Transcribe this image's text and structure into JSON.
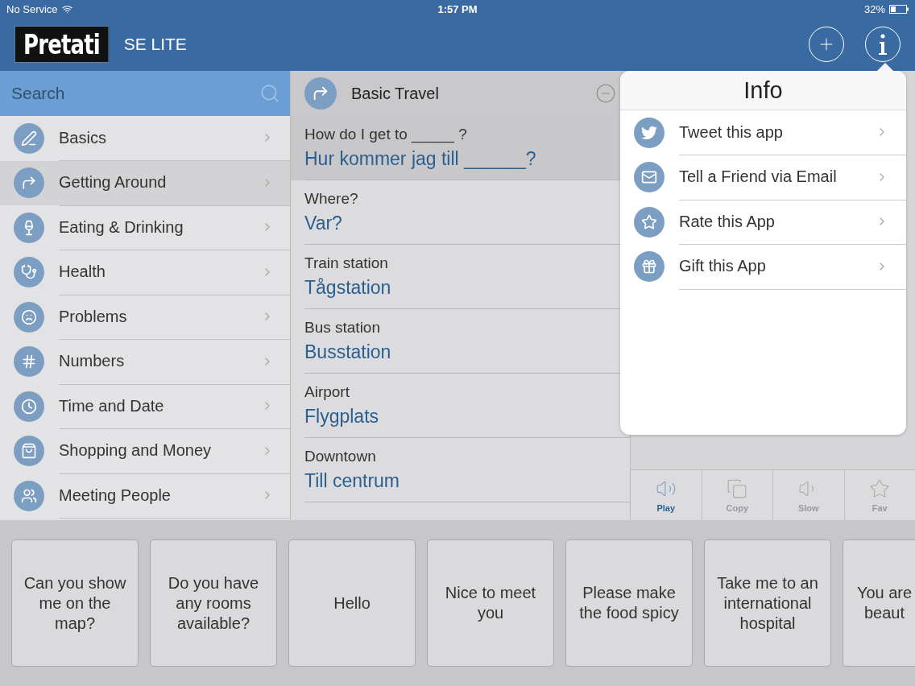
{
  "status_bar": {
    "carrier": "No Service",
    "time": "1:57 PM",
    "battery": "32%"
  },
  "header": {
    "logo": "Pretati",
    "edition": "SE LITE"
  },
  "sidebar": {
    "search": {
      "placeholder": "Search"
    },
    "items": [
      {
        "label": "Basics",
        "selected": false
      },
      {
        "label": "Getting Around",
        "selected": true
      },
      {
        "label": "Eating & Drinking",
        "selected": false
      },
      {
        "label": "Health",
        "selected": false
      },
      {
        "label": "Problems",
        "selected": false
      },
      {
        "label": "Numbers",
        "selected": false
      },
      {
        "label": "Time and Date",
        "selected": false
      },
      {
        "label": "Shopping and Money",
        "selected": false
      },
      {
        "label": "Meeting People",
        "selected": false
      }
    ]
  },
  "phrases": {
    "title": "Basic Travel",
    "items": [
      {
        "english": "How do I get to _____ ?",
        "translation": "Hur kommer jag till ______?",
        "selected": true
      },
      {
        "english": "Where?",
        "translation": "Var?",
        "selected": false
      },
      {
        "english": "Train station",
        "translation": "Tågstation",
        "selected": false
      },
      {
        "english": "Bus station",
        "translation": "Busstation",
        "selected": false
      },
      {
        "english": "Airport",
        "translation": "Flygplats",
        "selected": false
      },
      {
        "english": "Downtown",
        "translation": "Till centrum",
        "selected": false
      }
    ]
  },
  "actions": [
    {
      "label": "Play",
      "selected": true
    },
    {
      "label": "Copy",
      "selected": false
    },
    {
      "label": "Slow",
      "selected": false
    },
    {
      "label": "Fav",
      "selected": false
    }
  ],
  "info_popover": {
    "title": "Info",
    "items": [
      "Tweet this app",
      "Tell a Friend via Email",
      "Rate this App",
      "Gift this App"
    ]
  },
  "quick_phrases": [
    {
      "text": "Can you show me on the map?",
      "cut": false
    },
    {
      "text": "Do you have any rooms available?",
      "cut": false
    },
    {
      "text": "Hello",
      "cut": false
    },
    {
      "text": "Nice to meet you",
      "cut": false
    },
    {
      "text": "Please make the food spicy",
      "cut": false
    },
    {
      "text": "Take me to an international hospital",
      "cut": false
    },
    {
      "text": "You are beaut",
      "cut": true
    }
  ]
}
